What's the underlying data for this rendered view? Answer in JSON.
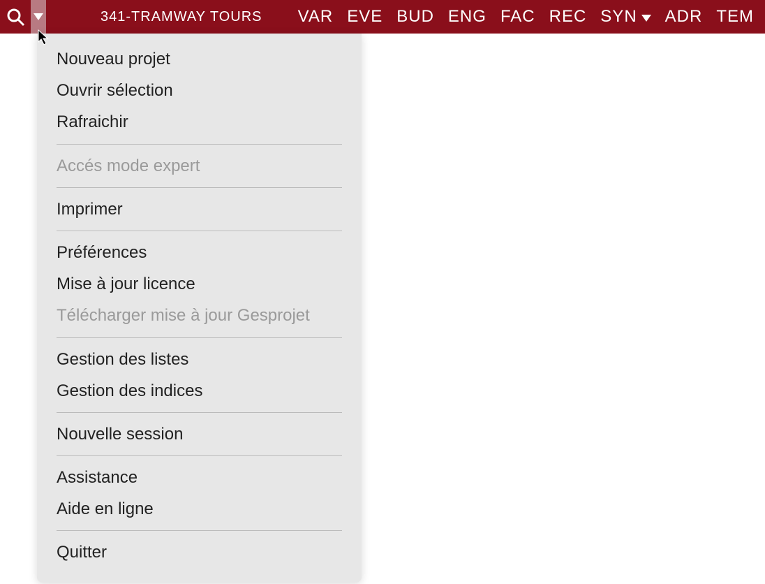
{
  "topbar": {
    "project_title": "341-TRAMWAY TOURS",
    "tabs": [
      {
        "label": "VAR",
        "has_dropdown": false
      },
      {
        "label": "EVE",
        "has_dropdown": false
      },
      {
        "label": "BUD",
        "has_dropdown": false
      },
      {
        "label": "ENG",
        "has_dropdown": false
      },
      {
        "label": "FAC",
        "has_dropdown": false
      },
      {
        "label": "REC",
        "has_dropdown": false
      },
      {
        "label": "SYN",
        "has_dropdown": true
      },
      {
        "label": "ADR",
        "has_dropdown": false
      },
      {
        "label": "TEM",
        "has_dropdown": false
      }
    ]
  },
  "dropdown_menu": {
    "groups": [
      [
        {
          "label": "Nouveau projet",
          "disabled": false
        },
        {
          "label": "Ouvrir sélection",
          "disabled": false
        },
        {
          "label": "Rafraichir",
          "disabled": false
        }
      ],
      [
        {
          "label": "Accés mode expert",
          "disabled": true
        }
      ],
      [
        {
          "label": "Imprimer",
          "disabled": false
        }
      ],
      [
        {
          "label": "Préférences",
          "disabled": false
        },
        {
          "label": "Mise à jour licence",
          "disabled": false
        },
        {
          "label": "Télécharger mise à jour Gesprojet",
          "disabled": true
        }
      ],
      [
        {
          "label": "Gestion des listes",
          "disabled": false
        },
        {
          "label": "Gestion des indices",
          "disabled": false
        }
      ],
      [
        {
          "label": "Nouvelle session",
          "disabled": false
        }
      ],
      [
        {
          "label": "Assistance",
          "disabled": false
        },
        {
          "label": "Aide en ligne",
          "disabled": false
        }
      ],
      [
        {
          "label": "Quitter",
          "disabled": false
        }
      ]
    ]
  }
}
